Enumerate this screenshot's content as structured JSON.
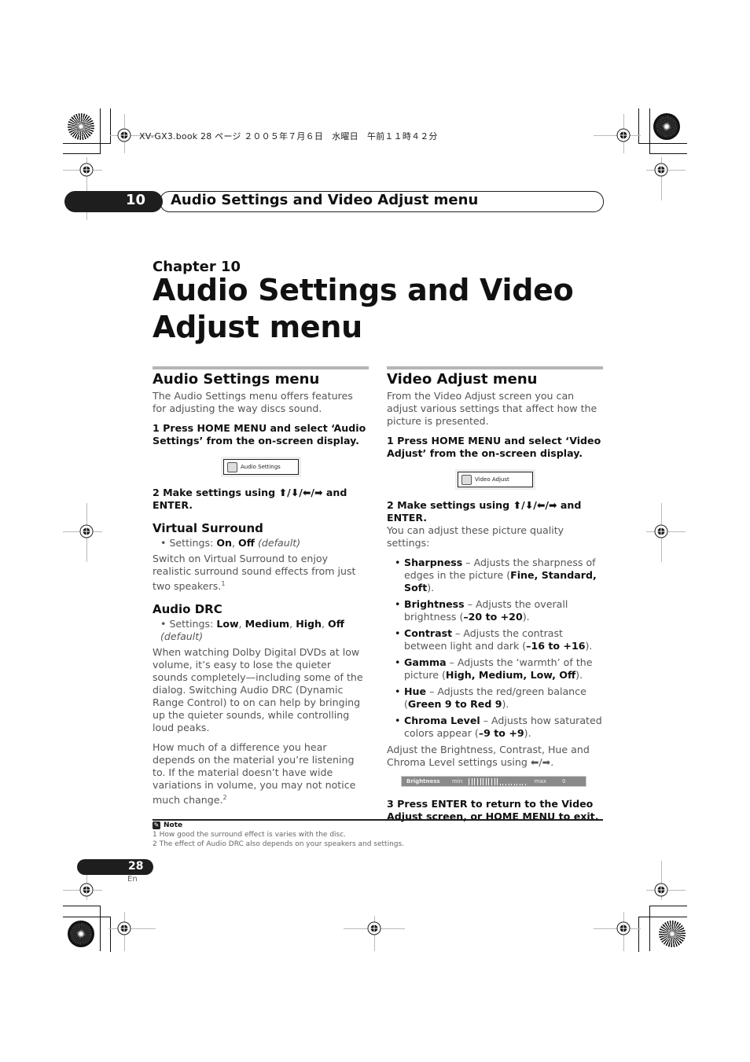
{
  "slug": "XV-GX3.book  28 ページ  ２００５年７月６日　水曜日　午前１１時４２分",
  "header": {
    "chapter_number": "10",
    "title": "Audio Settings and Video Adjust menu"
  },
  "chapter": {
    "label": "Chapter 10",
    "title": "Audio Settings and Video Adjust menu"
  },
  "audio": {
    "heading": "Audio Settings menu",
    "intro": "The Audio Settings menu offers features for adjusting the way discs sound.",
    "step1": "1    Press HOME MENU and select ‘Audio Settings’ from the on-screen display.",
    "osd_label": "Audio Settings",
    "osd_icon": "speaker-icon",
    "step2": "2    Make settings using ⬆/⬇/⬅/➡ and ENTER.",
    "virtual_surround": {
      "heading": "Virtual Surround",
      "settings_prefix": "Settings: ",
      "options": [
        "On",
        "Off"
      ],
      "default_note": "(default)",
      "body": "Switch on Virtual Surround to enjoy realistic surround sound effects from just two speakers.",
      "footnote_ref": "1"
    },
    "drc": {
      "heading": "Audio DRC",
      "settings_prefix": "Settings: ",
      "options": [
        "Low",
        "Medium",
        "High",
        "Off"
      ],
      "default_note": "(default)",
      "body1": "When watching Dolby Digital DVDs at low volume, it’s easy to lose the quieter sounds completely—including some of the dialog. Switching Audio DRC (Dynamic Range Control) to on can help by bringing up the quieter sounds, while controlling loud peaks.",
      "body2": "How much of a difference you hear depends on the material you’re listening to. If the material doesn’t have wide variations in volume, you may not notice much change.",
      "footnote_ref": "2"
    }
  },
  "video": {
    "heading": "Video Adjust menu",
    "intro": "From the Video Adjust screen you can adjust various settings that affect how the picture is presented.",
    "step1": "1    Press HOME MENU and select ‘Video Adjust’ from the on-screen display.",
    "osd_label": "Video Adjust",
    "osd_icon": "tv-icon",
    "step2": "2    Make settings using ⬆/⬇/⬅/➡ and ENTER.",
    "list_intro": "You can adjust these picture quality settings:",
    "items": [
      {
        "name": "Sharpness",
        "desc": " – Adjusts the sharpness of edges in the picture (",
        "range": "Fine, Standard, Soft",
        "end": ")."
      },
      {
        "name": "Brightness",
        "desc": " – Adjusts the overall brightness (",
        "range": "–20 to +20",
        "end": ")."
      },
      {
        "name": "Contrast",
        "desc": " – Adjusts the contrast between light and dark (",
        "range": "–16 to +16",
        "end": ")."
      },
      {
        "name": "Gamma",
        "desc": " – Adjusts the ‘warmth’ of the picture (",
        "range": "High, Medium, Low, Off",
        "end": ")."
      },
      {
        "name": "Hue",
        "desc": " – Adjusts the red/green balance (",
        "range": "Green 9 to Red 9",
        "end": ")."
      },
      {
        "name": "Chroma Level",
        "desc": " – Adjusts how saturated colors appear (",
        "range": "–9 to +9",
        "end": ")."
      }
    ],
    "adjust_note": "Adjust the Brightness, Contrast, Hue and Chroma Level settings using ⬅/➡.",
    "bar": {
      "label": "Brightness",
      "min_label": "min",
      "max_label": "max",
      "value": "0",
      "filled_fraction": 0.5
    },
    "step3": "3    Press ENTER to return to the Video Adjust screen, or HOME MENU to exit."
  },
  "notes": {
    "heading": "Note",
    "footnotes": [
      "1 How good the surround effect is varies with the disc.",
      "2 The effect of Audio DRC also depends on your speakers and settings."
    ]
  },
  "footer": {
    "page_number": "28",
    "language": "En"
  }
}
